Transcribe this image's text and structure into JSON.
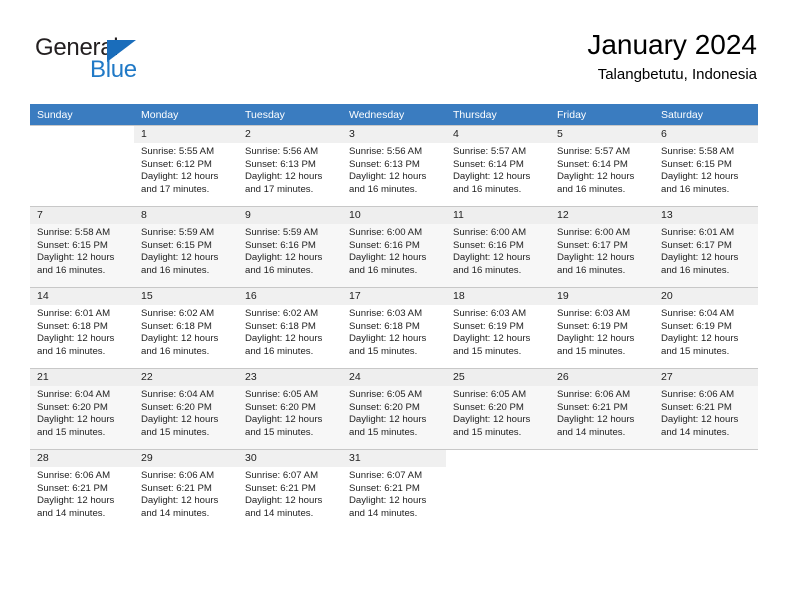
{
  "brand": {
    "name_top": "General",
    "name_bottom": "Blue",
    "accent_color": "#2079c6",
    "triangle_color": "#1a6dbb"
  },
  "header": {
    "title": "January 2024",
    "subtitle": "Talangbetutu, Indonesia"
  },
  "theme": {
    "header_row_bg": "#3a7cc0",
    "header_row_text": "#ffffff",
    "daynum_bg": "#f0f0f0",
    "grid_line": "#c8c8c8",
    "alt_row_bg": "#f7f7f7"
  },
  "weekdays": [
    "Sunday",
    "Monday",
    "Tuesday",
    "Wednesday",
    "Thursday",
    "Friday",
    "Saturday"
  ],
  "weeks": [
    [
      {
        "day": "",
        "blank": true
      },
      {
        "day": "1",
        "sunrise": "Sunrise: 5:55 AM",
        "sunset": "Sunset: 6:12 PM",
        "daylight1": "Daylight: 12 hours",
        "daylight2": "and 17 minutes."
      },
      {
        "day": "2",
        "sunrise": "Sunrise: 5:56 AM",
        "sunset": "Sunset: 6:13 PM",
        "daylight1": "Daylight: 12 hours",
        "daylight2": "and 17 minutes."
      },
      {
        "day": "3",
        "sunrise": "Sunrise: 5:56 AM",
        "sunset": "Sunset: 6:13 PM",
        "daylight1": "Daylight: 12 hours",
        "daylight2": "and 16 minutes."
      },
      {
        "day": "4",
        "sunrise": "Sunrise: 5:57 AM",
        "sunset": "Sunset: 6:14 PM",
        "daylight1": "Daylight: 12 hours",
        "daylight2": "and 16 minutes."
      },
      {
        "day": "5",
        "sunrise": "Sunrise: 5:57 AM",
        "sunset": "Sunset: 6:14 PM",
        "daylight1": "Daylight: 12 hours",
        "daylight2": "and 16 minutes."
      },
      {
        "day": "6",
        "sunrise": "Sunrise: 5:58 AM",
        "sunset": "Sunset: 6:15 PM",
        "daylight1": "Daylight: 12 hours",
        "daylight2": "and 16 minutes."
      }
    ],
    [
      {
        "day": "7",
        "sunrise": "Sunrise: 5:58 AM",
        "sunset": "Sunset: 6:15 PM",
        "daylight1": "Daylight: 12 hours",
        "daylight2": "and 16 minutes."
      },
      {
        "day": "8",
        "sunrise": "Sunrise: 5:59 AM",
        "sunset": "Sunset: 6:15 PM",
        "daylight1": "Daylight: 12 hours",
        "daylight2": "and 16 minutes."
      },
      {
        "day": "9",
        "sunrise": "Sunrise: 5:59 AM",
        "sunset": "Sunset: 6:16 PM",
        "daylight1": "Daylight: 12 hours",
        "daylight2": "and 16 minutes."
      },
      {
        "day": "10",
        "sunrise": "Sunrise: 6:00 AM",
        "sunset": "Sunset: 6:16 PM",
        "daylight1": "Daylight: 12 hours",
        "daylight2": "and 16 minutes."
      },
      {
        "day": "11",
        "sunrise": "Sunrise: 6:00 AM",
        "sunset": "Sunset: 6:16 PM",
        "daylight1": "Daylight: 12 hours",
        "daylight2": "and 16 minutes."
      },
      {
        "day": "12",
        "sunrise": "Sunrise: 6:00 AM",
        "sunset": "Sunset: 6:17 PM",
        "daylight1": "Daylight: 12 hours",
        "daylight2": "and 16 minutes."
      },
      {
        "day": "13",
        "sunrise": "Sunrise: 6:01 AM",
        "sunset": "Sunset: 6:17 PM",
        "daylight1": "Daylight: 12 hours",
        "daylight2": "and 16 minutes."
      }
    ],
    [
      {
        "day": "14",
        "sunrise": "Sunrise: 6:01 AM",
        "sunset": "Sunset: 6:18 PM",
        "daylight1": "Daylight: 12 hours",
        "daylight2": "and 16 minutes."
      },
      {
        "day": "15",
        "sunrise": "Sunrise: 6:02 AM",
        "sunset": "Sunset: 6:18 PM",
        "daylight1": "Daylight: 12 hours",
        "daylight2": "and 16 minutes."
      },
      {
        "day": "16",
        "sunrise": "Sunrise: 6:02 AM",
        "sunset": "Sunset: 6:18 PM",
        "daylight1": "Daylight: 12 hours",
        "daylight2": "and 16 minutes."
      },
      {
        "day": "17",
        "sunrise": "Sunrise: 6:03 AM",
        "sunset": "Sunset: 6:18 PM",
        "daylight1": "Daylight: 12 hours",
        "daylight2": "and 15 minutes."
      },
      {
        "day": "18",
        "sunrise": "Sunrise: 6:03 AM",
        "sunset": "Sunset: 6:19 PM",
        "daylight1": "Daylight: 12 hours",
        "daylight2": "and 15 minutes."
      },
      {
        "day": "19",
        "sunrise": "Sunrise: 6:03 AM",
        "sunset": "Sunset: 6:19 PM",
        "daylight1": "Daylight: 12 hours",
        "daylight2": "and 15 minutes."
      },
      {
        "day": "20",
        "sunrise": "Sunrise: 6:04 AM",
        "sunset": "Sunset: 6:19 PM",
        "daylight1": "Daylight: 12 hours",
        "daylight2": "and 15 minutes."
      }
    ],
    [
      {
        "day": "21",
        "sunrise": "Sunrise: 6:04 AM",
        "sunset": "Sunset: 6:20 PM",
        "daylight1": "Daylight: 12 hours",
        "daylight2": "and 15 minutes."
      },
      {
        "day": "22",
        "sunrise": "Sunrise: 6:04 AM",
        "sunset": "Sunset: 6:20 PM",
        "daylight1": "Daylight: 12 hours",
        "daylight2": "and 15 minutes."
      },
      {
        "day": "23",
        "sunrise": "Sunrise: 6:05 AM",
        "sunset": "Sunset: 6:20 PM",
        "daylight1": "Daylight: 12 hours",
        "daylight2": "and 15 minutes."
      },
      {
        "day": "24",
        "sunrise": "Sunrise: 6:05 AM",
        "sunset": "Sunset: 6:20 PM",
        "daylight1": "Daylight: 12 hours",
        "daylight2": "and 15 minutes."
      },
      {
        "day": "25",
        "sunrise": "Sunrise: 6:05 AM",
        "sunset": "Sunset: 6:20 PM",
        "daylight1": "Daylight: 12 hours",
        "daylight2": "and 15 minutes."
      },
      {
        "day": "26",
        "sunrise": "Sunrise: 6:06 AM",
        "sunset": "Sunset: 6:21 PM",
        "daylight1": "Daylight: 12 hours",
        "daylight2": "and 14 minutes."
      },
      {
        "day": "27",
        "sunrise": "Sunrise: 6:06 AM",
        "sunset": "Sunset: 6:21 PM",
        "daylight1": "Daylight: 12 hours",
        "daylight2": "and 14 minutes."
      }
    ],
    [
      {
        "day": "28",
        "sunrise": "Sunrise: 6:06 AM",
        "sunset": "Sunset: 6:21 PM",
        "daylight1": "Daylight: 12 hours",
        "daylight2": "and 14 minutes."
      },
      {
        "day": "29",
        "sunrise": "Sunrise: 6:06 AM",
        "sunset": "Sunset: 6:21 PM",
        "daylight1": "Daylight: 12 hours",
        "daylight2": "and 14 minutes."
      },
      {
        "day": "30",
        "sunrise": "Sunrise: 6:07 AM",
        "sunset": "Sunset: 6:21 PM",
        "daylight1": "Daylight: 12 hours",
        "daylight2": "and 14 minutes."
      },
      {
        "day": "31",
        "sunrise": "Sunrise: 6:07 AM",
        "sunset": "Sunset: 6:21 PM",
        "daylight1": "Daylight: 12 hours",
        "daylight2": "and 14 minutes."
      },
      {
        "day": "",
        "blank": true
      },
      {
        "day": "",
        "blank": true
      },
      {
        "day": "",
        "blank": true
      }
    ]
  ]
}
